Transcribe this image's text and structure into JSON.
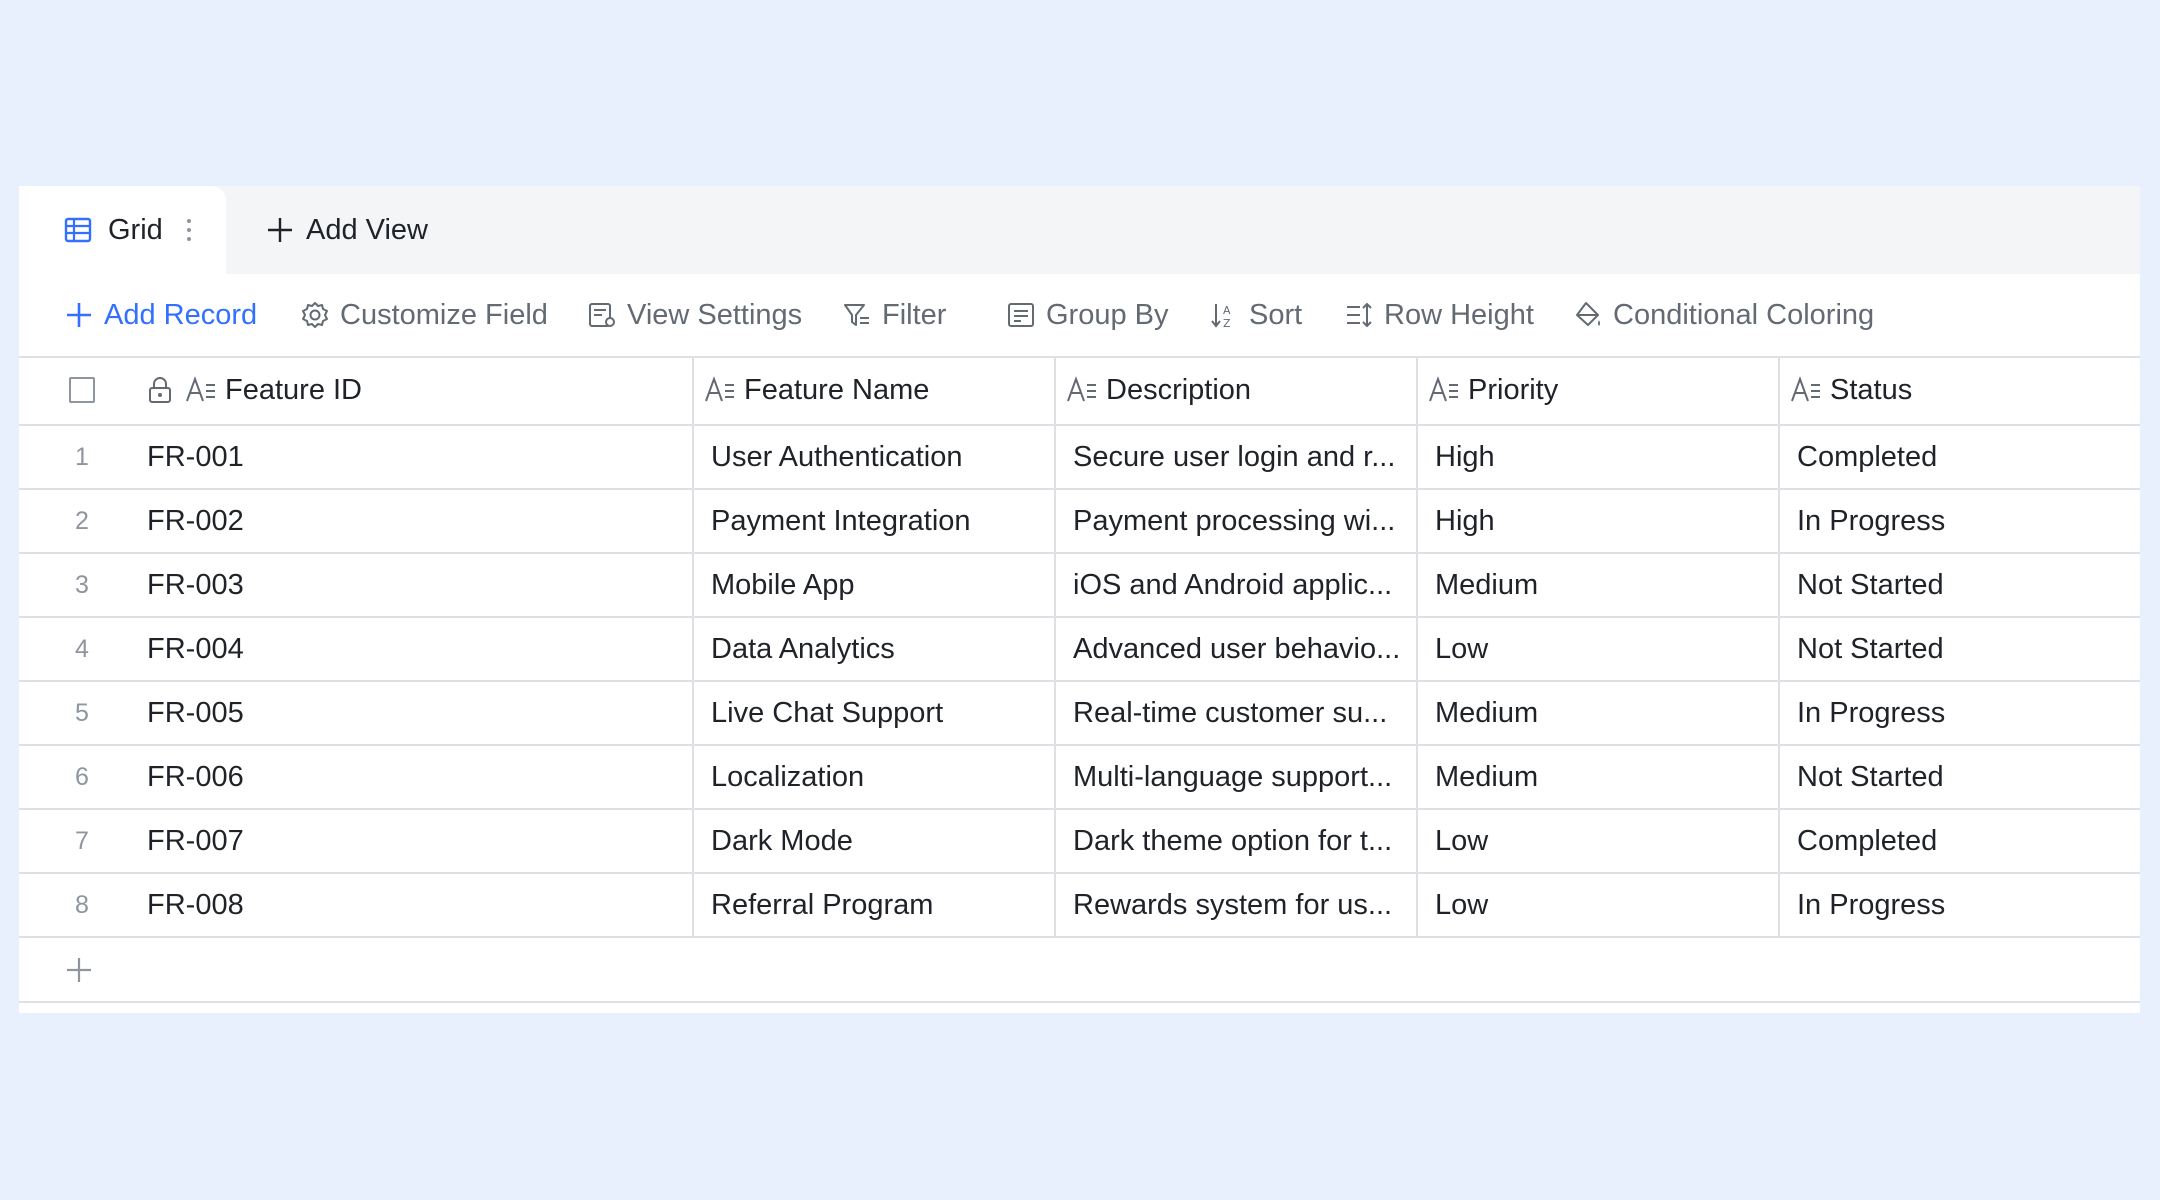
{
  "tabs": {
    "active_label": "Grid",
    "add_view_label": "Add View"
  },
  "toolbar": {
    "add_record": "Add Record",
    "customize_field": "Customize Field",
    "view_settings": "View Settings",
    "filter": "Filter",
    "group_by": "Group By",
    "sort": "Sort",
    "row_height": "Row Height",
    "conditional_coloring": "Conditional Coloring"
  },
  "columns": [
    "Feature ID",
    "Feature Name",
    "Description",
    "Priority",
    "Status"
  ],
  "rows": [
    {
      "num": "1",
      "id": "FR-001",
      "name": "User Authentication",
      "desc": "Secure user login and r...",
      "priority": "High",
      "status": "Completed"
    },
    {
      "num": "2",
      "id": "FR-002",
      "name": "Payment Integration",
      "desc": "Payment processing wi...",
      "priority": "High",
      "status": "In Progress"
    },
    {
      "num": "3",
      "id": "FR-003",
      "name": "Mobile App",
      "desc": "iOS and Android applic...",
      "priority": "Medium",
      "status": "Not Started"
    },
    {
      "num": "4",
      "id": "FR-004",
      "name": "Data Analytics",
      "desc": "Advanced user behavio...",
      "priority": "Low",
      "status": "Not Started"
    },
    {
      "num": "5",
      "id": "FR-005",
      "name": "Live Chat Support",
      "desc": "Real-time customer su...",
      "priority": "Medium",
      "status": "In Progress"
    },
    {
      "num": "6",
      "id": "FR-006",
      "name": "Localization",
      "desc": "Multi-language support...",
      "priority": "Medium",
      "status": "Not Started"
    },
    {
      "num": "7",
      "id": "FR-007",
      "name": "Dark Mode",
      "desc": "Dark theme option for t...",
      "priority": "Low",
      "status": "Completed"
    },
    {
      "num": "8",
      "id": "FR-008",
      "name": "Referral Program",
      "desc": "Rewards system for us...",
      "priority": "Low",
      "status": "In Progress"
    }
  ],
  "colors": {
    "accent": "#3370ff",
    "page_background": "#e8effd",
    "muted_text": "#646a73",
    "border": "#dee0e3"
  }
}
